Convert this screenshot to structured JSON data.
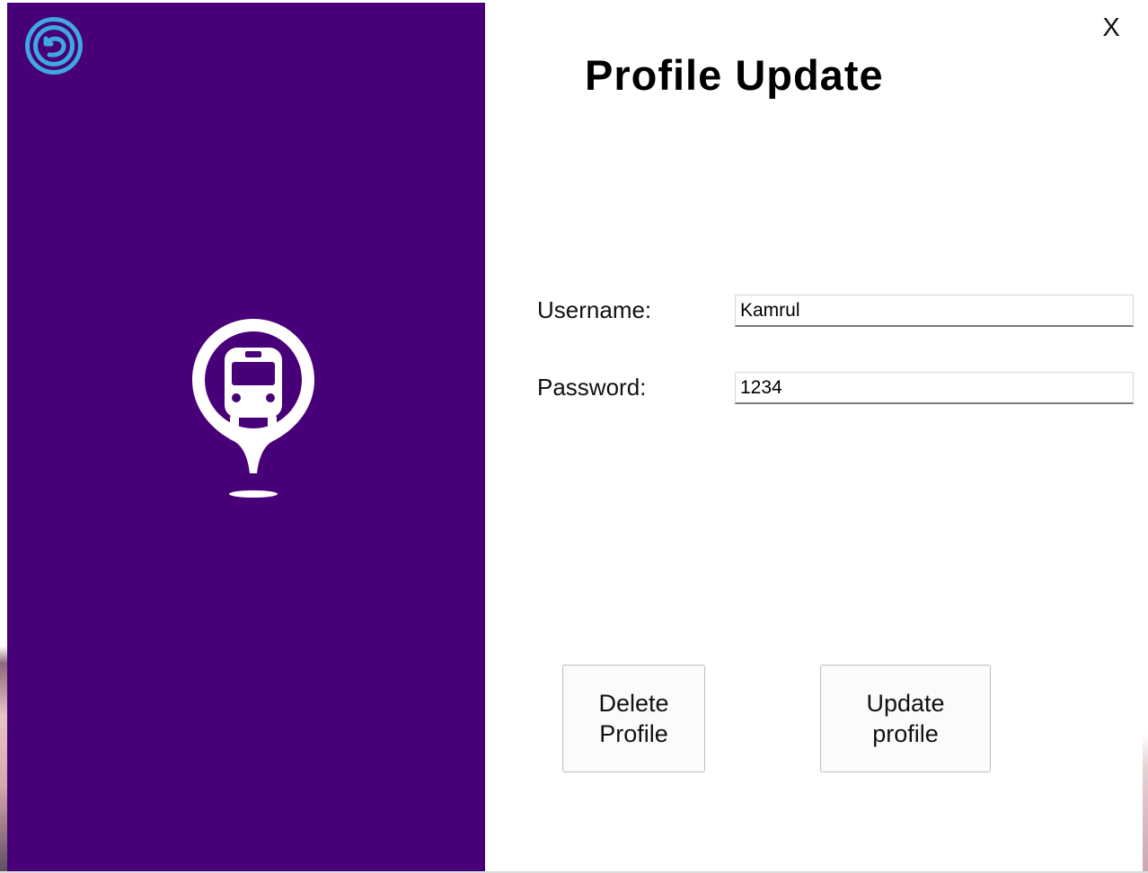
{
  "window": {
    "close_label": "X"
  },
  "sidebar": {
    "background_color": "#480078",
    "back_icon": "back-arrow-circle-icon",
    "logo_icon": "bus-stop-pin-icon"
  },
  "main": {
    "title": "Profile Update",
    "username": {
      "label": "Username:",
      "value": "Kamrul"
    },
    "password": {
      "label": "Password:",
      "value": "1234"
    },
    "buttons": {
      "delete_line1": "Delete",
      "delete_line2": "Profile",
      "update_line1": "Update",
      "update_line2": "profile"
    }
  },
  "colors": {
    "accent_icon": "#1fa6e0",
    "sidebar": "#480078"
  }
}
